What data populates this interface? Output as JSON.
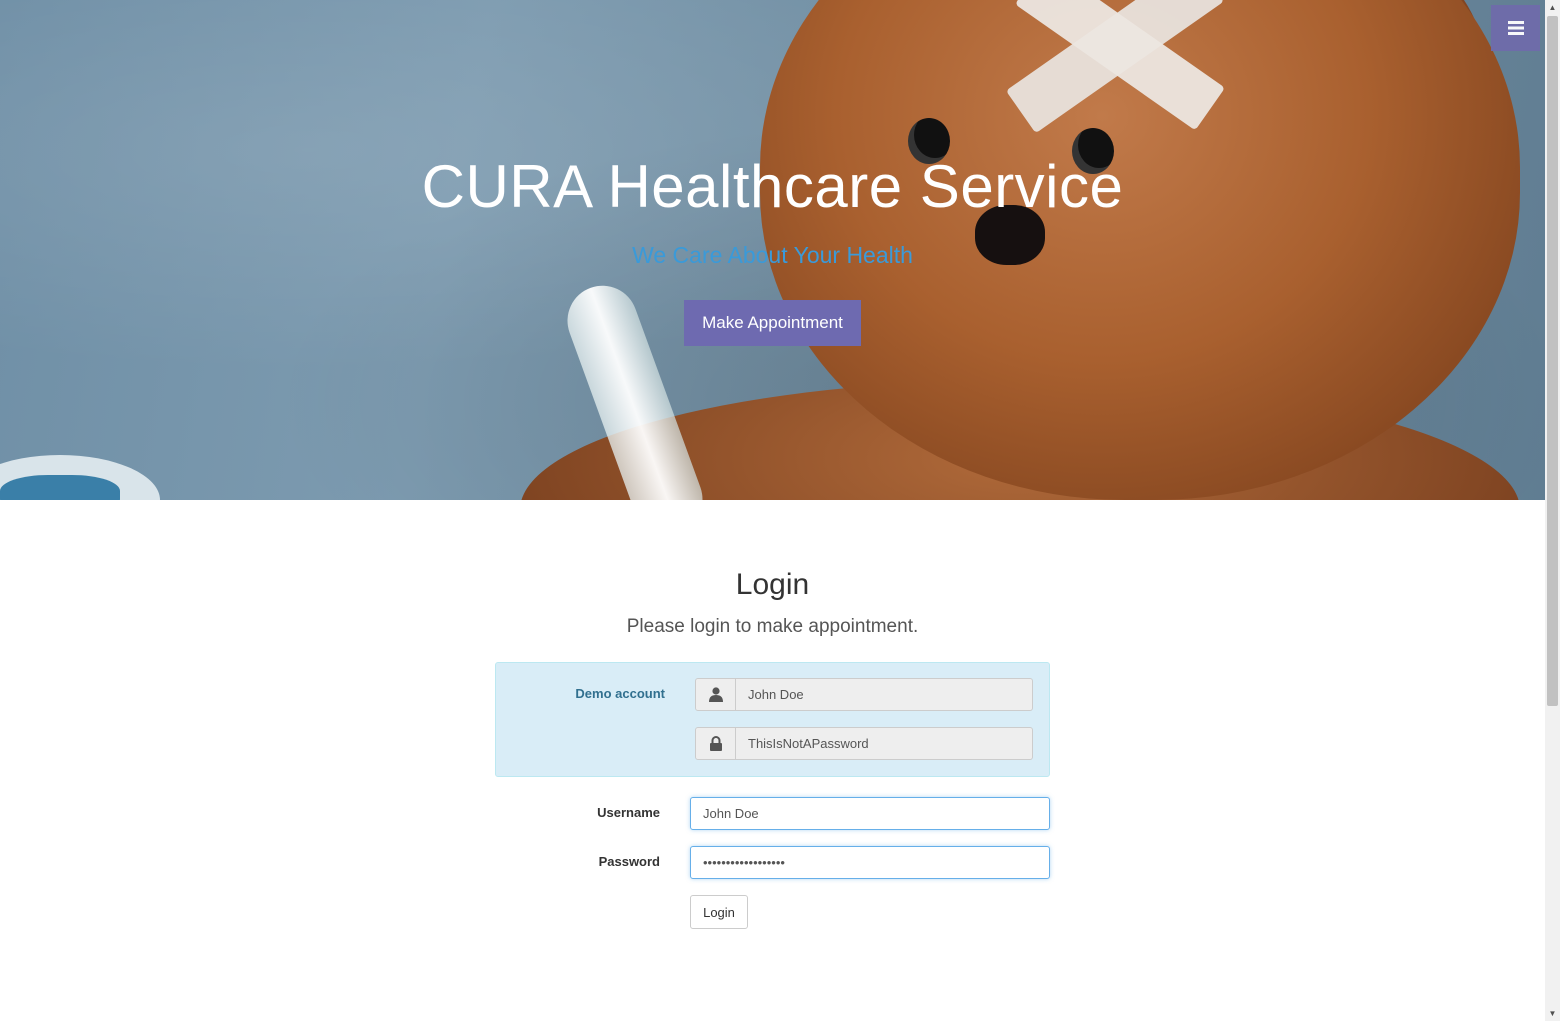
{
  "hero": {
    "title": "CURA Healthcare Service",
    "subtitle": "We Care About Your Health",
    "cta_label": "Make Appointment"
  },
  "login": {
    "title": "Login",
    "subtitle": "Please login to make appointment."
  },
  "demo": {
    "label": "Demo account",
    "username": "John Doe",
    "password": "ThisIsNotAPassword",
    "user_icon": "user-icon",
    "lock_icon": "lock-icon"
  },
  "form": {
    "username_label": "Username",
    "username_value": "John Doe",
    "password_label": "Password",
    "password_value": "ThisIsNotAPassword",
    "login_button": "Login"
  },
  "colors": {
    "accent": "#6e6ab0",
    "subtitle": "#3a9ad9",
    "demo_bg": "#d9edf7",
    "demo_text": "#31708f"
  },
  "icons": {
    "menu": "menu-icon"
  }
}
